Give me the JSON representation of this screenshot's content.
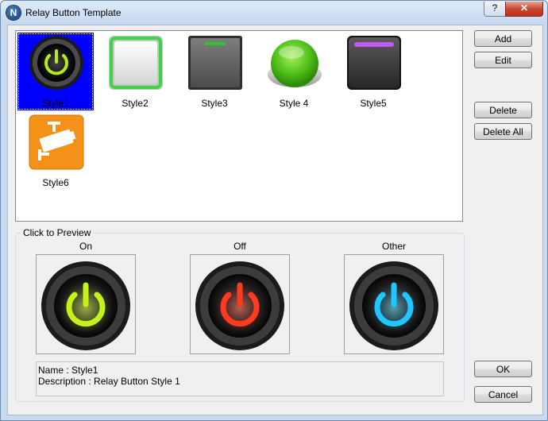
{
  "window": {
    "title": "Relay Button Template",
    "help_label": "?",
    "close_label": "✕",
    "app_icon_letter": "N"
  },
  "list": {
    "items": [
      {
        "label": "Style1",
        "icon": "power-button-green-glow",
        "selected": true
      },
      {
        "label": "Style2",
        "icon": "white-square-green-border-button"
      },
      {
        "label": "Style3",
        "icon": "gray-square-green-led-button"
      },
      {
        "label": "Style 4",
        "icon": "green-round-push-button"
      },
      {
        "label": "Style5",
        "icon": "dark-square-purple-led-button"
      },
      {
        "label": "Style6",
        "icon": "orange-cctv-camera-button"
      }
    ]
  },
  "buttons": {
    "add": "Add",
    "edit": "Edit",
    "delete": "Delete",
    "delete_all": "Delete All",
    "ok": "OK",
    "cancel": "Cancel"
  },
  "preview": {
    "legend": "Click to Preview",
    "on_label": "On",
    "off_label": "Off",
    "other_label": "Other",
    "on_color": "#c6f21b",
    "off_color": "#ff3b1f",
    "other_color": "#1ec8ff"
  },
  "info": {
    "name": "Name : Style1",
    "description": "Description  : Relay Button Style 1"
  }
}
